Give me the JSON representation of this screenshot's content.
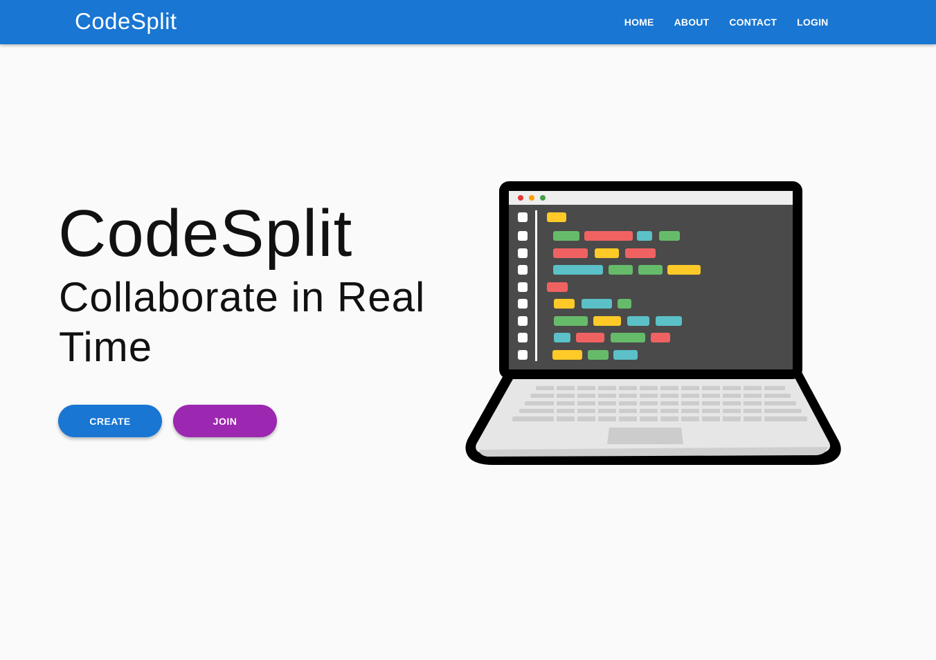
{
  "navbar": {
    "brand": "CodeSplit",
    "links": [
      "HOME",
      "ABOUT",
      "CONTACT",
      "LOGIN"
    ],
    "background_color": "#1976d2"
  },
  "hero": {
    "title": "CodeSplit",
    "subtitle": "Collaborate in Real Time",
    "buttons": {
      "create": "CREATE",
      "join": "JOIN"
    },
    "create_color": "#1976d2",
    "join_color": "#9c27b0"
  },
  "illustration": {
    "icon": "laptop-code-illustration",
    "window_dots": [
      "#e53935",
      "#ffa000",
      "#43a047"
    ],
    "code_colors": [
      "#ffca28",
      "#66bb6a",
      "#f06262",
      "#5bc0c7"
    ]
  }
}
